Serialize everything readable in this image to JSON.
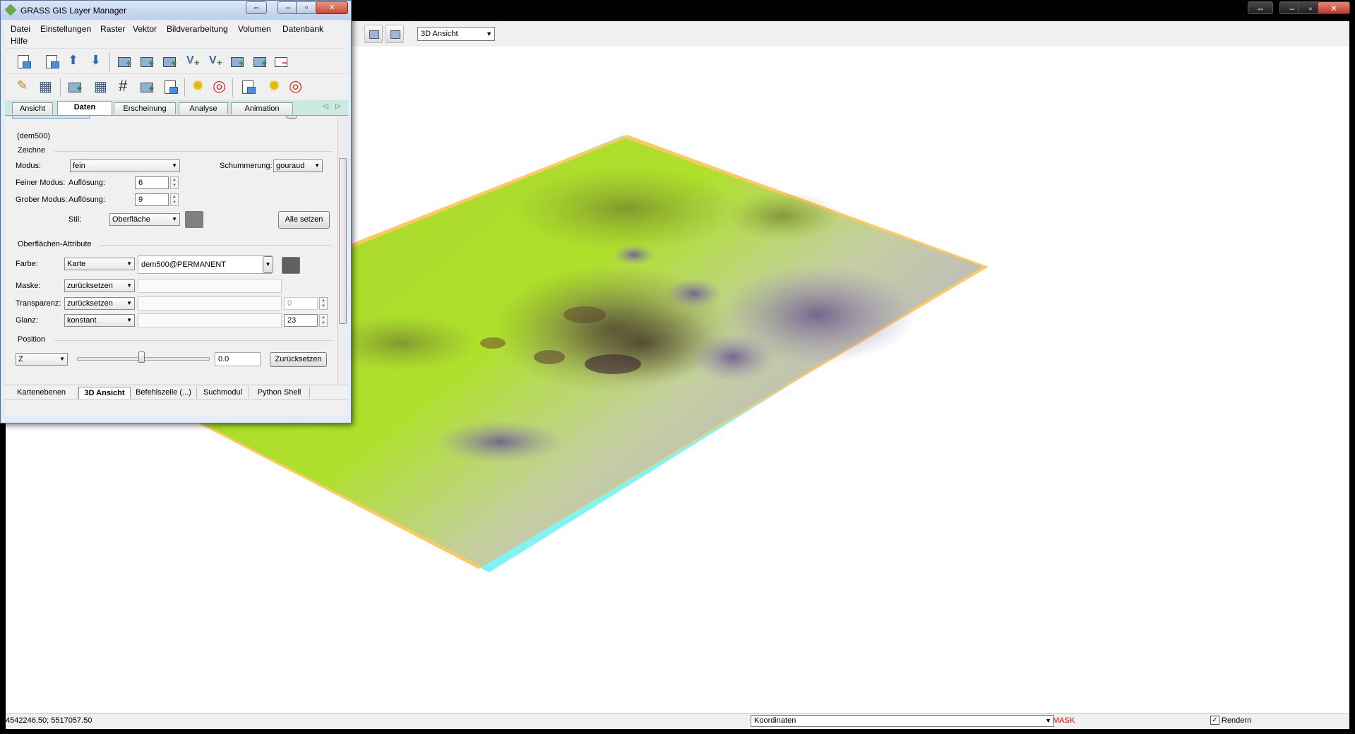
{
  "map_window": {
    "toolbar": {
      "view_mode": "3D Ansicht"
    },
    "status": {
      "coordinates": "4542246.50; 5517057.50",
      "display_mode": "Koordinaten",
      "mask": "MASK",
      "render_label": "Rendern",
      "render_checked": "✓"
    }
  },
  "layer_manager": {
    "title": "GRASS GIS Layer Manager",
    "menu": [
      "Datei",
      "Einstellungen",
      "Raster",
      "Vektor",
      "Bildverarbeitung",
      "Volumen",
      "Datenbank",
      "Hilfe"
    ],
    "tabs": [
      "Ansicht",
      "Daten",
      "Erscheinung",
      "Analyse",
      "Animation"
    ],
    "panel": {
      "surface_name": "(dem500)",
      "draw_group": "Zeichne",
      "mode_label": "Modus:",
      "mode_value": "fein",
      "shading_label": "Schummerung:",
      "shading_value": "gouraud",
      "fine_label": "Feiner Modus:",
      "fine_res_label": "Auflösung:",
      "fine_res_value": "6",
      "coarse_label": "Grober Modus:",
      "coarse_res_label": "Auflösung:",
      "coarse_res_value": "9",
      "style_label": "Stil:",
      "style_value": "Oberfläche",
      "set_all_button": "Alle setzen",
      "attr_group": "Oberflächen-Attribute",
      "color_label": "Farbe:",
      "color_type": "Karte",
      "color_map": "dem500@PERMANENT",
      "mask_label": "Maske:",
      "mask_type": "zurücksetzen",
      "transparency_label": "Transparenz:",
      "transparency_type": "zurücksetzen",
      "transparency_value": "0",
      "shine_label": "Glanz:",
      "shine_type": "konstant",
      "shine_value": "23",
      "position_group": "Position",
      "axis_value": "Z",
      "position_value": "0.0",
      "reset_button": "Zurücksetzen"
    },
    "bottom_tabs": [
      "Kartenebenen",
      "3D Ansicht",
      "Befehlszeile (...)",
      "Suchmodul",
      "Python Shell"
    ]
  },
  "colors": {
    "surface_green": "#a8d82a",
    "surface_purple": "#9b8bb8",
    "anaglyph_cyan": "#7ff3f5",
    "anaglyph_orange": "#ffc860",
    "mask_red": "#e00000"
  }
}
